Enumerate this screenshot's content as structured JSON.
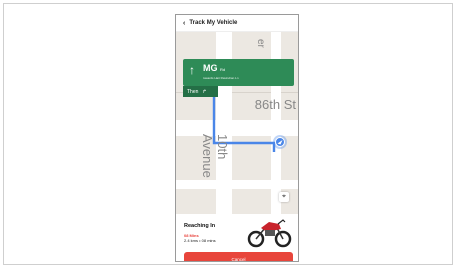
{
  "header": {
    "title": "Track My Vehicle"
  },
  "navigation": {
    "road": "MG",
    "road_suffix": "Rd",
    "towards": "towards Hari Ravindran Ln",
    "then_label": "Then"
  },
  "map": {
    "street_86": "86th St",
    "avenue_10": "10th Avenue",
    "street_top": "er"
  },
  "status": {
    "title": "Reaching In",
    "mins": "08 Mins",
    "distance": "2.4 kms • 08 mins"
  },
  "actions": {
    "cancel": "Cancel"
  },
  "colors": {
    "route": "#4a86e8",
    "nav_green": "#2e8b57",
    "cancel_red": "#e8453b"
  }
}
